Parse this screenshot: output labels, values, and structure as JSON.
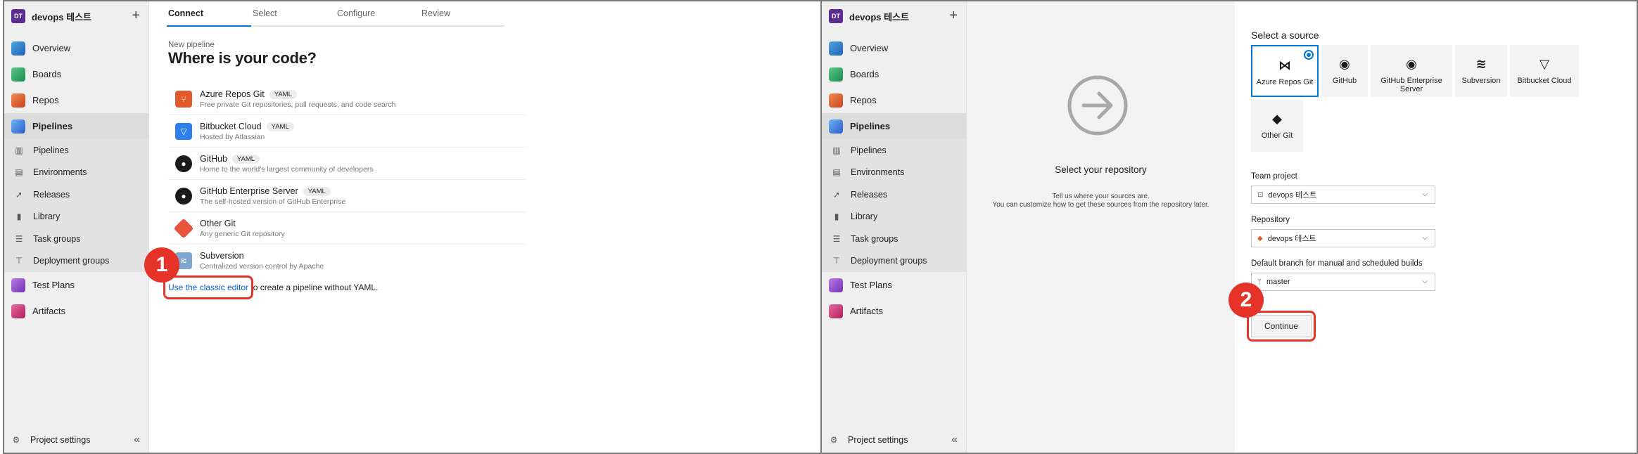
{
  "org": {
    "avatar_text": "DT",
    "name": "devops 테스트"
  },
  "sidebar": {
    "overview": "Overview",
    "boards": "Boards",
    "repos": "Repos",
    "pipelines": "Pipelines",
    "sub_pipelines": "Pipelines",
    "environments": "Environments",
    "releases": "Releases",
    "library": "Library",
    "task_groups": "Task groups",
    "deployment_groups": "Deployment groups",
    "test_plans": "Test Plans",
    "artifacts": "Artifacts",
    "project_settings": "Project settings"
  },
  "wizard": {
    "step1": "Connect",
    "step2": "Select",
    "step3": "Configure",
    "step4": "Review"
  },
  "left": {
    "new_pipeline": "New pipeline",
    "title": "Where is your code?",
    "yaml": "YAML",
    "sources": [
      {
        "name": "Azure Repos Git",
        "desc": "Free private Git repositories, pull requests, and code search",
        "yaml": true
      },
      {
        "name": "Bitbucket Cloud",
        "desc": "Hosted by Atlassian",
        "yaml": true
      },
      {
        "name": "GitHub",
        "desc": "Home to the world's largest community of developers",
        "yaml": true
      },
      {
        "name": "GitHub Enterprise Server",
        "desc": "The self-hosted version of GitHub Enterprise",
        "yaml": true
      },
      {
        "name": "Other Git",
        "desc": "Any generic Git repository",
        "yaml": false
      },
      {
        "name": "Subversion",
        "desc": "Centralized version control by Apache",
        "yaml": false
      }
    ],
    "classic_link": "Use the classic editor",
    "classic_rest": " to create a pipeline without YAML.",
    "callout": "1"
  },
  "right": {
    "repo_title": "Select your repository",
    "repo_sub1": "Tell us where your sources are.",
    "repo_sub2": "You can customize how to get these sources from the repository later.",
    "select_source": "Select a source",
    "tiles": {
      "azure": "Azure Repos Git",
      "github": "GitHub",
      "ghe_line1": "GitHub Enterprise",
      "ghe_line2": "Server",
      "svn": "Subversion",
      "bitbucket": "Bitbucket Cloud",
      "other": "Other Git"
    },
    "team_project_label": "Team project",
    "team_project_value": "devops 테스트",
    "repository_label": "Repository",
    "repository_value": "devops 테스트",
    "branch_label": "Default branch for manual and scheduled builds",
    "branch_value": "master",
    "continue": "Continue",
    "callout": "2"
  }
}
